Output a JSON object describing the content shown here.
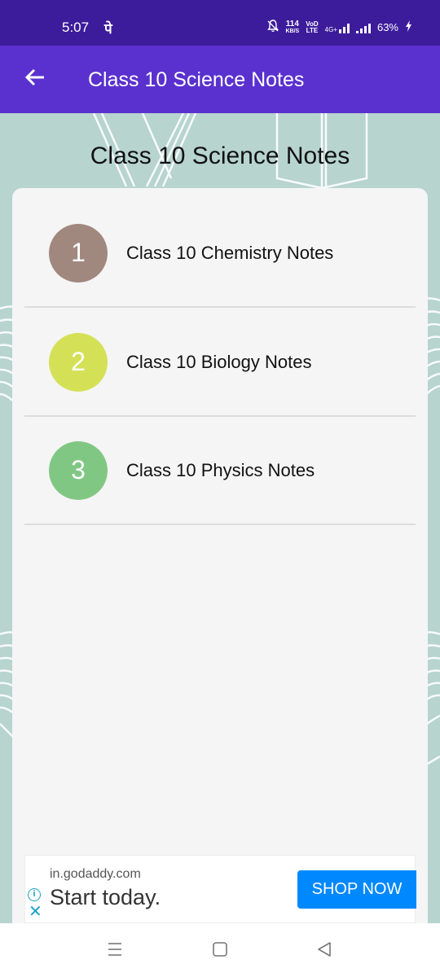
{
  "status_bar": {
    "time": "5:07",
    "notification_glyph": "पे",
    "net_speed_value": "114",
    "net_speed_unit": "KB/S",
    "volte_top": "VoD",
    "volte_bottom": "LTE",
    "network_type": "4G+",
    "battery": "63%"
  },
  "app_bar": {
    "title": "Class 10 Science Notes",
    "back_icon": "arrow-left-icon"
  },
  "page": {
    "heading": "Class 10 Science Notes"
  },
  "list": {
    "items": [
      {
        "number": "1",
        "label": "Class 10 Chemistry Notes",
        "color": "#a1887f"
      },
      {
        "number": "2",
        "label": "Class 10 Biology Notes",
        "color": "#d4e157"
      },
      {
        "number": "3",
        "label": "Class 10 Physics Notes",
        "color": "#81c784"
      }
    ]
  },
  "ad": {
    "domain": "in.godaddy.com",
    "headline": "Start today.",
    "cta": "SHOP NOW",
    "info_icon": "i",
    "close_icon": "✕"
  },
  "colors": {
    "status_bar": "#3c1c9b",
    "app_bar": "#5a31cf",
    "background": "#b7d4cf",
    "card": "#f5f5f5",
    "cta": "#0088ff"
  }
}
